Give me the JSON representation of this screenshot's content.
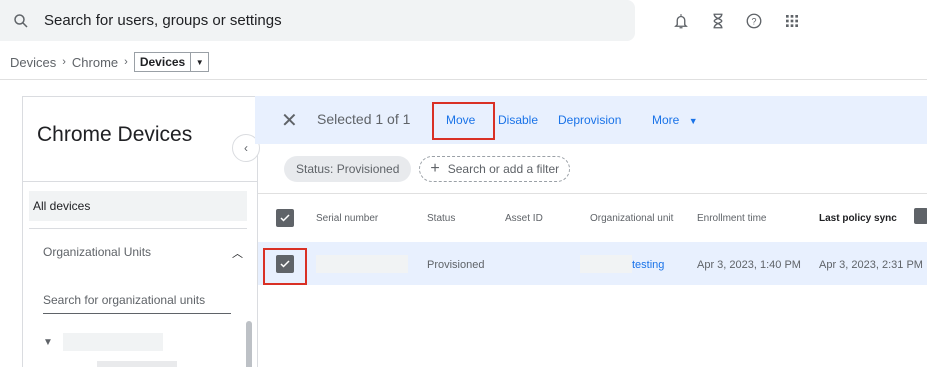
{
  "search": {
    "placeholder": "Search for users, groups or settings"
  },
  "breadcrumb": {
    "items": [
      "Devices",
      "Chrome"
    ],
    "current": "Devices"
  },
  "sidebar": {
    "title": "Chrome Devices",
    "all_devices": "All devices",
    "org_units_label": "Organizational Units",
    "org_search_placeholder": "Search for organizational units"
  },
  "action_bar": {
    "selected_text": "Selected 1 of 1",
    "move": "Move",
    "disable": "Disable",
    "deprovision": "Deprovision",
    "more": "More"
  },
  "filters": {
    "status_chip": "Status: Provisioned",
    "add_filter": "Search or add a filter"
  },
  "table": {
    "columns": [
      "Serial number",
      "Status",
      "Asset ID",
      "Organizational unit",
      "Enrollment time",
      "Last policy sync"
    ],
    "rows": [
      {
        "status": "Provisioned",
        "org_unit": "testing",
        "enrollment_time": "Apr 3, 2023, 1:40 PM",
        "last_policy_sync": "Apr 3, 2023, 2:31 PM",
        "selected": true
      }
    ]
  },
  "colors": {
    "accent": "#1a73e8",
    "highlight": "#d93025",
    "selection_bg": "#e8f0fe"
  }
}
